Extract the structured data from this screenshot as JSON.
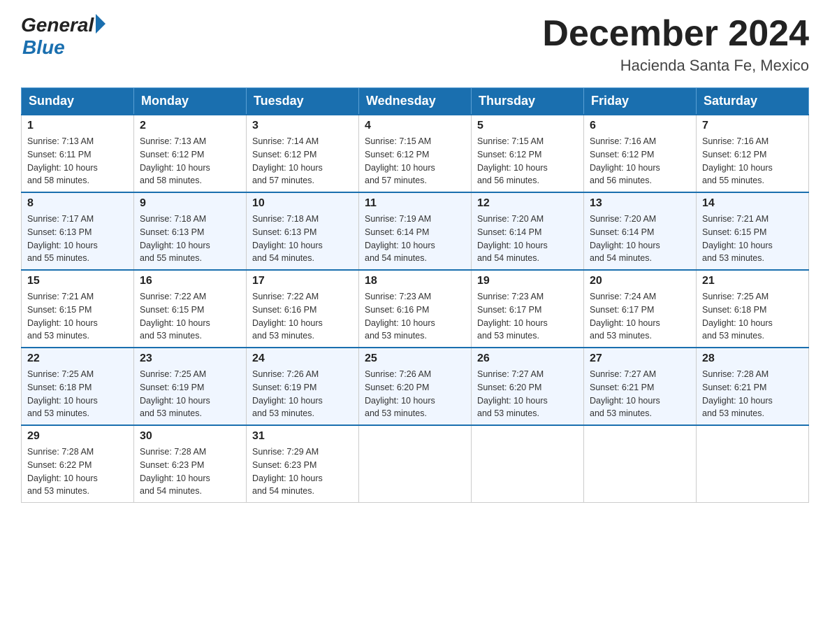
{
  "logo": {
    "general": "General",
    "blue": "Blue"
  },
  "title": "December 2024",
  "location": "Hacienda Santa Fe, Mexico",
  "days_of_week": [
    "Sunday",
    "Monday",
    "Tuesday",
    "Wednesday",
    "Thursday",
    "Friday",
    "Saturday"
  ],
  "weeks": [
    [
      {
        "day": "1",
        "sunrise": "7:13 AM",
        "sunset": "6:11 PM",
        "daylight": "10 hours and 58 minutes."
      },
      {
        "day": "2",
        "sunrise": "7:13 AM",
        "sunset": "6:12 PM",
        "daylight": "10 hours and 58 minutes."
      },
      {
        "day": "3",
        "sunrise": "7:14 AM",
        "sunset": "6:12 PM",
        "daylight": "10 hours and 57 minutes."
      },
      {
        "day": "4",
        "sunrise": "7:15 AM",
        "sunset": "6:12 PM",
        "daylight": "10 hours and 57 minutes."
      },
      {
        "day": "5",
        "sunrise": "7:15 AM",
        "sunset": "6:12 PM",
        "daylight": "10 hours and 56 minutes."
      },
      {
        "day": "6",
        "sunrise": "7:16 AM",
        "sunset": "6:12 PM",
        "daylight": "10 hours and 56 minutes."
      },
      {
        "day": "7",
        "sunrise": "7:16 AM",
        "sunset": "6:12 PM",
        "daylight": "10 hours and 55 minutes."
      }
    ],
    [
      {
        "day": "8",
        "sunrise": "7:17 AM",
        "sunset": "6:13 PM",
        "daylight": "10 hours and 55 minutes."
      },
      {
        "day": "9",
        "sunrise": "7:18 AM",
        "sunset": "6:13 PM",
        "daylight": "10 hours and 55 minutes."
      },
      {
        "day": "10",
        "sunrise": "7:18 AM",
        "sunset": "6:13 PM",
        "daylight": "10 hours and 54 minutes."
      },
      {
        "day": "11",
        "sunrise": "7:19 AM",
        "sunset": "6:14 PM",
        "daylight": "10 hours and 54 minutes."
      },
      {
        "day": "12",
        "sunrise": "7:20 AM",
        "sunset": "6:14 PM",
        "daylight": "10 hours and 54 minutes."
      },
      {
        "day": "13",
        "sunrise": "7:20 AM",
        "sunset": "6:14 PM",
        "daylight": "10 hours and 54 minutes."
      },
      {
        "day": "14",
        "sunrise": "7:21 AM",
        "sunset": "6:15 PM",
        "daylight": "10 hours and 53 minutes."
      }
    ],
    [
      {
        "day": "15",
        "sunrise": "7:21 AM",
        "sunset": "6:15 PM",
        "daylight": "10 hours and 53 minutes."
      },
      {
        "day": "16",
        "sunrise": "7:22 AM",
        "sunset": "6:15 PM",
        "daylight": "10 hours and 53 minutes."
      },
      {
        "day": "17",
        "sunrise": "7:22 AM",
        "sunset": "6:16 PM",
        "daylight": "10 hours and 53 minutes."
      },
      {
        "day": "18",
        "sunrise": "7:23 AM",
        "sunset": "6:16 PM",
        "daylight": "10 hours and 53 minutes."
      },
      {
        "day": "19",
        "sunrise": "7:23 AM",
        "sunset": "6:17 PM",
        "daylight": "10 hours and 53 minutes."
      },
      {
        "day": "20",
        "sunrise": "7:24 AM",
        "sunset": "6:17 PM",
        "daylight": "10 hours and 53 minutes."
      },
      {
        "day": "21",
        "sunrise": "7:25 AM",
        "sunset": "6:18 PM",
        "daylight": "10 hours and 53 minutes."
      }
    ],
    [
      {
        "day": "22",
        "sunrise": "7:25 AM",
        "sunset": "6:18 PM",
        "daylight": "10 hours and 53 minutes."
      },
      {
        "day": "23",
        "sunrise": "7:25 AM",
        "sunset": "6:19 PM",
        "daylight": "10 hours and 53 minutes."
      },
      {
        "day": "24",
        "sunrise": "7:26 AM",
        "sunset": "6:19 PM",
        "daylight": "10 hours and 53 minutes."
      },
      {
        "day": "25",
        "sunrise": "7:26 AM",
        "sunset": "6:20 PM",
        "daylight": "10 hours and 53 minutes."
      },
      {
        "day": "26",
        "sunrise": "7:27 AM",
        "sunset": "6:20 PM",
        "daylight": "10 hours and 53 minutes."
      },
      {
        "day": "27",
        "sunrise": "7:27 AM",
        "sunset": "6:21 PM",
        "daylight": "10 hours and 53 minutes."
      },
      {
        "day": "28",
        "sunrise": "7:28 AM",
        "sunset": "6:21 PM",
        "daylight": "10 hours and 53 minutes."
      }
    ],
    [
      {
        "day": "29",
        "sunrise": "7:28 AM",
        "sunset": "6:22 PM",
        "daylight": "10 hours and 53 minutes."
      },
      {
        "day": "30",
        "sunrise": "7:28 AM",
        "sunset": "6:23 PM",
        "daylight": "10 hours and 54 minutes."
      },
      {
        "day": "31",
        "sunrise": "7:29 AM",
        "sunset": "6:23 PM",
        "daylight": "10 hours and 54 minutes."
      },
      null,
      null,
      null,
      null
    ]
  ]
}
